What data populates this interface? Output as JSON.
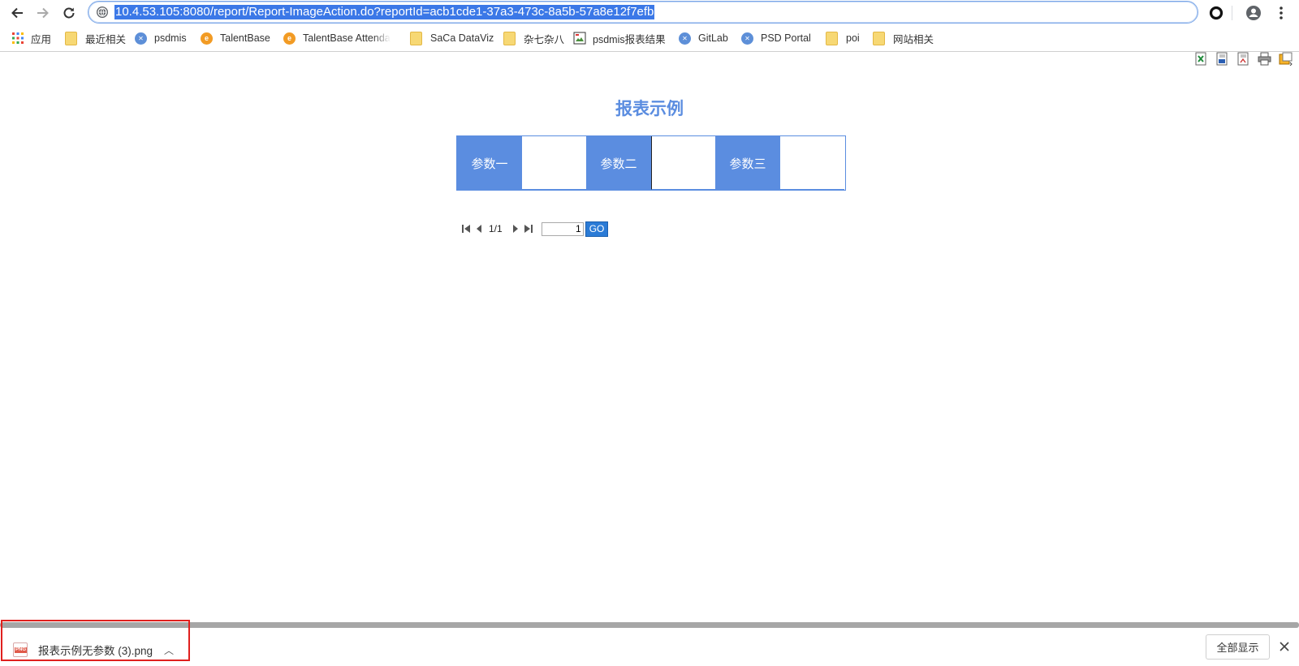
{
  "browser": {
    "url": "10.4.53.105:8080/report/Report-ImageAction.do?reportId=acb1cde1-37a3-473c-8a5b-57a8e12f7efb"
  },
  "bookmarks": [
    {
      "label": "应用",
      "icon": "apps-grid-icon"
    },
    {
      "label": "最近相关",
      "icon": "folder-icon"
    },
    {
      "label": "psdmis",
      "icon": "psd-site-icon"
    },
    {
      "label": "TalentBase",
      "icon": "talentbase-icon"
    },
    {
      "label": "TalentBase Attenda",
      "icon": "talentbase-icon"
    },
    {
      "label": "SaCa DataViz",
      "icon": "folder-icon"
    },
    {
      "label": "杂七杂八",
      "icon": "folder-icon"
    },
    {
      "label": "psdmis报表结果",
      "icon": "image-icon"
    },
    {
      "label": "GitLab",
      "icon": "psd-site-icon"
    },
    {
      "label": "PSD Portal",
      "icon": "psd-site-icon"
    },
    {
      "label": "poi",
      "icon": "folder-icon"
    },
    {
      "label": "网站相关",
      "icon": "folder-icon"
    }
  ],
  "report": {
    "title": "报表示例",
    "params": [
      {
        "label": "参数一",
        "value": ""
      },
      {
        "label": "参数二",
        "value": ""
      },
      {
        "label": "参数三",
        "value": ""
      }
    ],
    "pager": {
      "page_text": "1/1",
      "page_input": "1",
      "go_label": "GO"
    },
    "tools": [
      "export-excel-icon",
      "export-word-icon",
      "export-pdf-icon",
      "print-icon",
      "export-image-icon"
    ]
  },
  "downloads": {
    "file_name": "报表示例无参数 (3).png",
    "file_icon": "PNG",
    "show_all_label": "全部显示"
  },
  "colors": {
    "accent": "#5b8de0",
    "url_highlight": "#3b78e7",
    "go_button": "#2b7bd6",
    "annotation_red": "#e0201e"
  }
}
